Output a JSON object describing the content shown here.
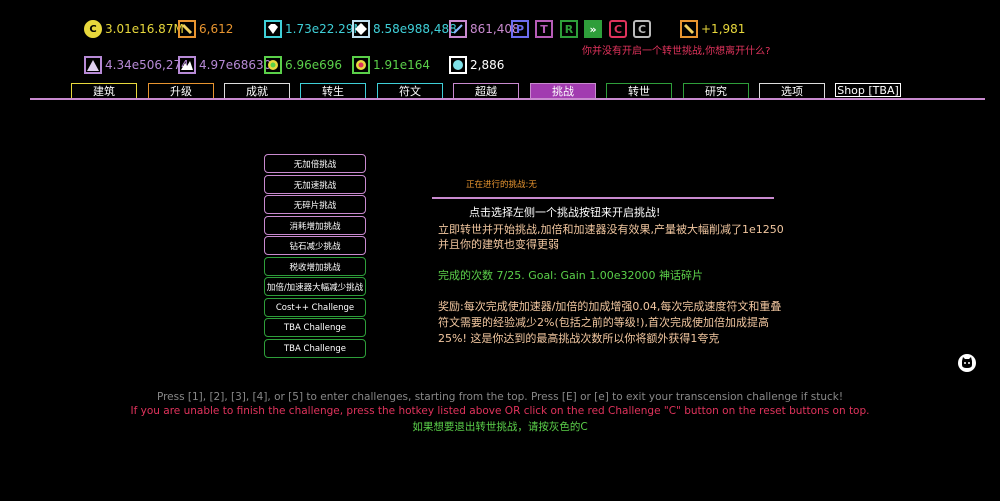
{
  "currencies": {
    "gold": {
      "value": "3.01e16.87M",
      "icon": "coin-icon",
      "color": "#e8d83c"
    },
    "wood": {
      "value": "6,612",
      "icon": "log-icon",
      "color": "#e89530"
    },
    "diamond": {
      "value": "1.73e22.29M",
      "icon": "diamond-icon",
      "color": "#3fd0d8"
    },
    "shard": {
      "value": "8.58e988,488",
      "icon": "shard-icon",
      "color": "#c0e0f0"
    },
    "mana": {
      "value": "861,408",
      "icon": "wand-icon",
      "color": "#c98acf"
    },
    "plus": {
      "value": "+1,981",
      "icon": "log-icon",
      "color": "#e89530"
    },
    "crystal": {
      "value": "4.34e506,274",
      "icon": "crystal-icon",
      "color": "#b78ad6"
    },
    "mountain": {
      "value": "4.97e68630",
      "icon": "mountain-icon",
      "color": "#b78ad6"
    },
    "green_orb": {
      "value": "6.96e696",
      "icon": "green-orb-icon",
      "color": "#5bd04a"
    },
    "red_orb": {
      "value": "1.91e164",
      "icon": "red-orb-icon",
      "color": "#5bd04a"
    },
    "white_orb": {
      "value": "2,886",
      "icon": "white-orb-icon",
      "color": "#ffffff"
    }
  },
  "reset_buttons": [
    {
      "label": "P",
      "color": "#6c6cf0"
    },
    {
      "label": "T",
      "color": "#b75cb7"
    },
    {
      "label": "R",
      "color": "#2e9e3a"
    },
    {
      "label": "»",
      "color": "#2e9e3a"
    },
    {
      "label": "C",
      "color": "#e0335c"
    },
    {
      "label": "C",
      "color": "#bbbbbb"
    }
  ],
  "warning": "你并没有开启一个转世挑战,你想离开什么?",
  "tabs": [
    {
      "label": "建筑",
      "color": "#e8d83c"
    },
    {
      "label": "升级",
      "color": "#e89530"
    },
    {
      "label": "成就",
      "color": "#dddddd"
    },
    {
      "label": "转生",
      "color": "#3fd0d8"
    },
    {
      "label": "符文",
      "color": "#3fd0d8"
    },
    {
      "label": "超越",
      "color": "#c98acf"
    },
    {
      "label": "挑战",
      "color": "#c98acf"
    },
    {
      "label": "转世",
      "color": "#2e9e3a"
    },
    {
      "label": "研究",
      "color": "#2e9e3a"
    },
    {
      "label": "选项",
      "color": "#dddddd"
    },
    {
      "label": "Shop [TBA]",
      "color": "#ffffff"
    }
  ],
  "active_tab_index": 6,
  "challenges": [
    {
      "label": "无加倍挑战",
      "color": "pink"
    },
    {
      "label": "无加速挑战",
      "color": "pink"
    },
    {
      "label": "无碎片挑战",
      "color": "pink"
    },
    {
      "label": "消耗增加挑战",
      "color": "pink"
    },
    {
      "label": "钻石减少挑战",
      "color": "pink"
    },
    {
      "label": "税收增加挑战",
      "color": "green"
    },
    {
      "label": "加倍/加速器大幅减少挑战",
      "color": "green"
    },
    {
      "label": "Cost++ Challenge",
      "color": "green"
    },
    {
      "label": "TBA Challenge",
      "color": "green"
    },
    {
      "label": "TBA Challenge",
      "color": "green"
    }
  ],
  "panel": {
    "current": "正在进行的挑战:无",
    "hint": "点击选择左侧一个挑战按钮来开启挑战!",
    "desc1": "立即转世并开始挑战,加倍和加速器没有效果,产量被大幅削减了1e1250",
    "desc2": "并且你的建筑也变得更弱",
    "completions": "完成的次数 7/25. Goal: Gain 1.00e32000 神话碎片",
    "reward1": "奖励:每次完成使加速器/加倍的加成增强0.04,每次完成速度符文和重叠",
    "reward2": "符文需要的经验减少2%(包括之前的等级!),首次完成使加倍加成提高",
    "reward3": "25%! 这是你达到的最高挑战次数所以你将额外获得1夸克"
  },
  "footer": {
    "line1": "Press [1], [2], [3], [4], or [5] to enter challenges, starting from the top. Press [E] or [e] to exit your transcension challenge if stuck!",
    "line2": "If you are unable to finish the challenge, press the hotkey listed above OR click on the red Challenge \"C\" button on the reset buttons on top.",
    "line3": "如果想要退出转世挑战，请按灰色的C"
  },
  "github_icon": "github-cat-icon"
}
